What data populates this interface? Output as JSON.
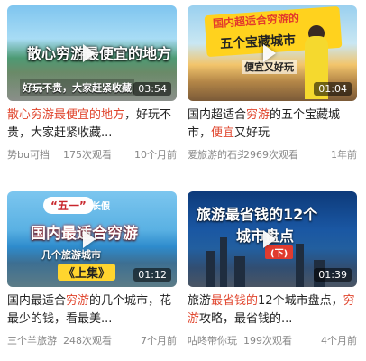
{
  "videos": [
    {
      "overlay": {
        "line1": "散心穷游最便宜的地方",
        "line2": "好玩不贵，大家赶紧收藏"
      },
      "duration": "03:54",
      "title_parts": [
        {
          "text": "散心穷游最便宜的地方",
          "highlight": true
        },
        {
          "text": "，好玩不贵，大家赶紧收藏...",
          "highlight": false
        }
      ],
      "author": "势bu可挡",
      "views": "175次观看",
      "time": "10个月前"
    },
    {
      "overlay": {
        "line1": "国内超适合穷游的",
        "line2": "五个宝藏城市",
        "line3": "便宜又好玩"
      },
      "duration": "01:04",
      "title_parts": [
        {
          "text": "国内超适合",
          "highlight": false
        },
        {
          "text": "穷游",
          "highlight": true
        },
        {
          "text": "的五个宝藏城市，",
          "highlight": false
        },
        {
          "text": "便宜",
          "highlight": true
        },
        {
          "text": "又好玩",
          "highlight": false
        }
      ],
      "author": "爱旅游的石头",
      "views": "2969次观看",
      "time": "1年前"
    },
    {
      "overlay": {
        "line1": "“五一”",
        "line2": "小长假",
        "line3": "国内最适合穷游",
        "line4": "几个旅游城市",
        "line5": "《上集》"
      },
      "duration": "01:12",
      "title_parts": [
        {
          "text": "国内最适合",
          "highlight": false
        },
        {
          "text": "穷游",
          "highlight": true
        },
        {
          "text": "的几个城市，花最少的钱，看最美...",
          "highlight": false
        }
      ],
      "author": "三个羊旅游",
      "views": "248次观看",
      "time": "7个月前"
    },
    {
      "overlay": {
        "line1": "旅游最省钱的12个",
        "line2": "城市盘点",
        "line3": "(下)"
      },
      "duration": "01:39",
      "title_parts": [
        {
          "text": "旅游",
          "highlight": false
        },
        {
          "text": "最省钱的",
          "highlight": true
        },
        {
          "text": "12个城市盘点，",
          "highlight": false
        },
        {
          "text": "穷游",
          "highlight": true
        },
        {
          "text": "攻略，最省钱的...",
          "highlight": false
        }
      ],
      "author": "咕咚带你玩",
      "views": "199次观看",
      "time": "4个月前"
    }
  ],
  "colors": {
    "highlight": "#e0452d",
    "meta": "#888888"
  },
  "icons": {
    "play": "play-icon"
  }
}
